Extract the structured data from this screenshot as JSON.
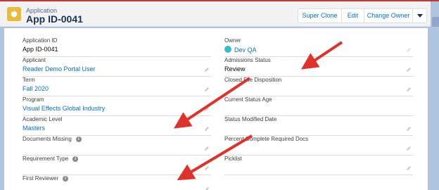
{
  "header": {
    "object_label": "Application",
    "title": "App ID-0041",
    "buttons": [
      "Super Clone",
      "Edit",
      "Change Owner"
    ],
    "menu_icon": "chevron-down-icon"
  },
  "fields": {
    "application_id": {
      "label": "Application ID",
      "value": "App ID-0041"
    },
    "applicant": {
      "label": "Applicant",
      "value": "Reader Demo Portal User"
    },
    "term": {
      "label": "Term",
      "value": "Fall 2020"
    },
    "program": {
      "label": "Program",
      "value": "Visual Effects Global Industry"
    },
    "academic_level": {
      "label": "Academic Level",
      "value": "Masters"
    },
    "documents_missing": {
      "label": "Documents Missing",
      "value": ""
    },
    "requirement_type": {
      "label": "Requirement Type",
      "value": ""
    },
    "first_reviewer": {
      "label": "First Reviewer",
      "value": ""
    },
    "owner": {
      "label": "Owner",
      "value": "Dev QA"
    },
    "admissions_status": {
      "label": "Admissions Status",
      "value": "Review"
    },
    "closed_file_disposition": {
      "label": "Closed File Disposition",
      "value": ""
    },
    "current_status_age": {
      "label": "Current Status Age",
      "value": ""
    },
    "status_modified_date": {
      "label": "Status Modified Date",
      "value": ""
    },
    "percent_complete": {
      "label": "Percent Complete Required Docs",
      "value": ""
    },
    "picklist": {
      "label": "Picklist",
      "value": ""
    }
  },
  "colors": {
    "accent": "#0070d2",
    "annotation_arrow": "#e0312b",
    "app_icon": "#e7bb3b",
    "top_border": "#c23934"
  }
}
